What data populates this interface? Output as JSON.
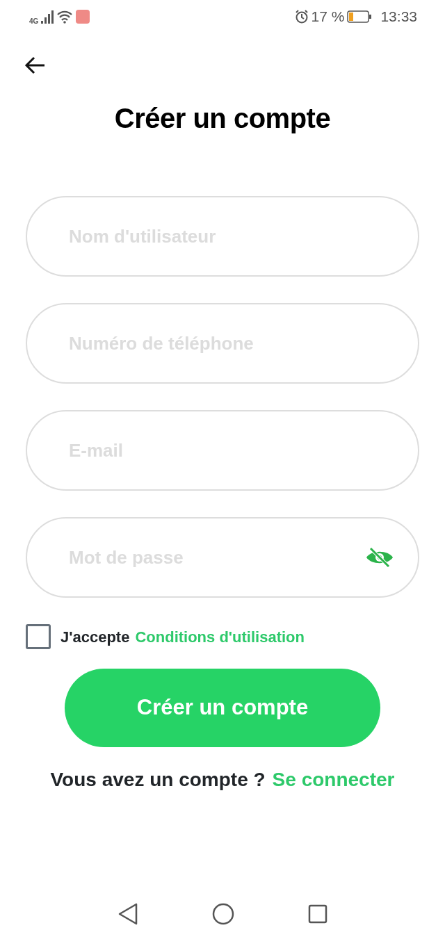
{
  "status_bar": {
    "network": "4G",
    "battery": "17 %",
    "time": "13:33"
  },
  "title": "Créer un compte",
  "fields": [
    {
      "placeholder": "Nom d'utilisateur",
      "kind": "text"
    },
    {
      "placeholder": "Numéro de téléphone",
      "kind": "text"
    },
    {
      "placeholder": "E-mail",
      "kind": "text"
    },
    {
      "placeholder": "Mot de passe",
      "kind": "password",
      "password_visible": false
    }
  ],
  "terms": {
    "checked": false,
    "label": "J'accepte",
    "link": "Conditions d'utilisation"
  },
  "submit_button": "Créer un compte",
  "login_prompt": {
    "text": "Vous avez un compte ?",
    "link": "Se connecter"
  }
}
